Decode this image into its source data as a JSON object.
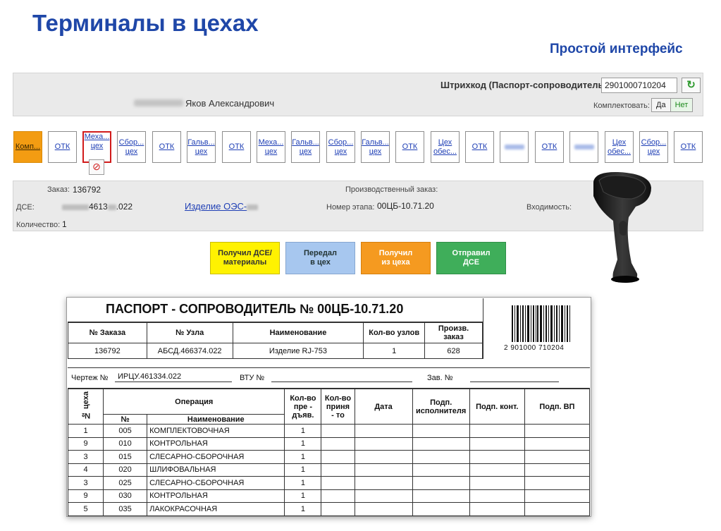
{
  "page": {
    "title": "Терминалы в цехах",
    "subtitle": "Простой интерфейс"
  },
  "top_panel": {
    "barcode_label": "Штрихкод (Паспорт-сопроводитель):",
    "barcode_value": "2901000710204",
    "user_name": "Яков Александрович",
    "komplekt_label": "Комплектовать:",
    "toggle_yes": "Да",
    "toggle_no": "Нет"
  },
  "workshops": [
    {
      "label": "Комп..."
    },
    {
      "label": "ОТК"
    },
    {
      "label": "Меха...\nцех"
    },
    {
      "label": "Сбор...\nцех"
    },
    {
      "label": "ОТК"
    },
    {
      "label": "Гальв...\nцех"
    },
    {
      "label": "ОТК"
    },
    {
      "label": "Меха...\nцех"
    },
    {
      "label": "Гальв...\nцех"
    },
    {
      "label": "Сбор...\nцех"
    },
    {
      "label": "Гальв...\nцех"
    },
    {
      "label": "ОТК"
    },
    {
      "label": "Цех\nобес..."
    },
    {
      "label": "ОТК"
    },
    {
      "label": ""
    },
    {
      "label": "ОТК"
    },
    {
      "label": ""
    },
    {
      "label": "Цех\nобес..."
    },
    {
      "label": "Сбор...\nцех"
    },
    {
      "label": "ОТК"
    }
  ],
  "info": {
    "order_label": "Заказ:",
    "order_value": "136792",
    "dse_label": "ДСЕ:",
    "dse_value_a": "4613",
    "dse_value_b": ".022",
    "qty_label": "Количество:",
    "qty_value": "1",
    "product_link": "Изделие ОЭС-",
    "prod_order_label": "Производственный заказ:",
    "stage_label": "Номер этапа:",
    "stage_value": "00ЦБ-10.71.20",
    "entry_label": "Входимость:"
  },
  "actions": {
    "received_dse": "Получил ДСЕ/\nматериалы",
    "passed": "Передал\nв цех",
    "received_ceh": "Получил\nиз цеха",
    "sent": "Отправил\nДСЕ"
  },
  "passport": {
    "title": "ПАСПОРТ - СОПРОВОДИТЕЛЬ № 00ЦБ-10.71.20",
    "barcode_number": "2 901000 710204",
    "header_cols": [
      "№ Заказа",
      "№ Узла",
      "Наименование",
      "Кол-во узлов",
      "Произв.\nзаказ"
    ],
    "header_vals": [
      "136792",
      "АБСД.466374.022",
      "Изделие RJ-753",
      "1",
      "628"
    ],
    "drawing_label": "Чертеж №",
    "drawing_value": "ИРЦУ.461334.022",
    "vtu_label": "ВТУ №",
    "zav_label": "Зав. №",
    "ops_headers": {
      "ceh": "№ цеха",
      "operation": "Операция",
      "num": "№",
      "name": "Наименование",
      "qty_presented": "Кол-во\nпре -\nдъяв.",
      "qty_accepted": "Кол-во\nприня\n- то",
      "date": "Дата",
      "sign_exec": "Подп.\nисполнителя",
      "sign_control": "Подп. конт.",
      "sign_vp": "Подп. ВП"
    },
    "operations": [
      {
        "ceh": "1",
        "num": "005",
        "name": "КОМПЛЕКТОВОЧНАЯ",
        "qty": "1"
      },
      {
        "ceh": "9",
        "num": "010",
        "name": "КОНТРОЛЬНАЯ",
        "qty": "1"
      },
      {
        "ceh": "3",
        "num": "015",
        "name": "СЛЕСАРНО-СБОРОЧНАЯ",
        "qty": "1"
      },
      {
        "ceh": "4",
        "num": "020",
        "name": "ШЛИФОВАЛЬНАЯ",
        "qty": "1"
      },
      {
        "ceh": "3",
        "num": "025",
        "name": "СЛЕСАРНО-СБОРОЧНАЯ",
        "qty": "1"
      },
      {
        "ceh": "9",
        "num": "030",
        "name": "КОНТРОЛЬНАЯ",
        "qty": "1"
      },
      {
        "ceh": "5",
        "num": "035",
        "name": "ЛАКОКРАСОЧНАЯ",
        "qty": "1"
      }
    ]
  },
  "colors": {
    "title_blue": "#1f47a8",
    "link_blue": "#1f3fb5",
    "orange": "#f39c12",
    "yellow": "#fff201",
    "light_blue": "#a7c7ef",
    "green": "#3fae5a"
  }
}
